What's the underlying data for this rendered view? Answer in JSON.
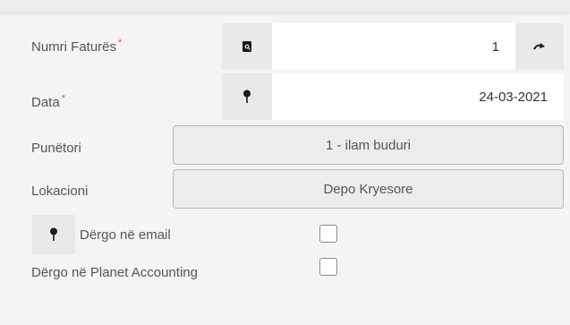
{
  "form": {
    "invoice_number": {
      "label": "Numri Faturës",
      "required_mark": "*",
      "value": "1",
      "icon": "search-doc-icon",
      "action_icon": "redo-icon"
    },
    "date": {
      "label": "Data",
      "required_mark": "*",
      "value": "24-03-2021",
      "icon": "pin-icon"
    },
    "employee": {
      "label": "Punëtori",
      "value": "1 - ilam buduri"
    },
    "location": {
      "label": "Lokacioni",
      "value": "Depo Kryesore"
    },
    "send_email": {
      "label": "Dërgo në email",
      "checked": false,
      "icon": "pin-icon"
    },
    "send_planet": {
      "label": "Dërgo në Planet Accounting",
      "checked": false
    }
  }
}
